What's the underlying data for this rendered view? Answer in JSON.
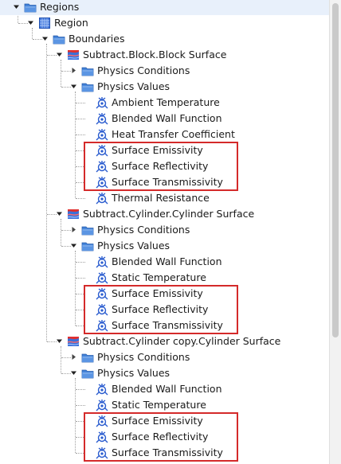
{
  "tree": [
    {
      "label": "Regions",
      "level": 1,
      "icon": "folder",
      "toggle": "expanded"
    },
    {
      "label": "Region",
      "level": 2,
      "icon": "region",
      "toggle": "expanded"
    },
    {
      "label": "Boundaries",
      "level": 3,
      "icon": "folder",
      "toggle": "expanded"
    },
    {
      "label": "Subtract.Block.Block Surface",
      "level": 4,
      "icon": "boundary",
      "toggle": "expanded"
    },
    {
      "label": "Physics Conditions",
      "level": 5,
      "icon": "folder",
      "toggle": "collapsed"
    },
    {
      "label": "Physics Values",
      "level": 5,
      "icon": "folder",
      "toggle": "expanded"
    },
    {
      "label": "Ambient Temperature",
      "level": 6,
      "icon": "value",
      "toggle": "none"
    },
    {
      "label": "Blended Wall Function",
      "level": 6,
      "icon": "value",
      "toggle": "none"
    },
    {
      "label": "Heat Transfer Coefficient",
      "level": 6,
      "icon": "value",
      "toggle": "none"
    },
    {
      "label": "Surface Emissivity",
      "level": 6,
      "icon": "value",
      "toggle": "none"
    },
    {
      "label": "Surface Reflectivity",
      "level": 6,
      "icon": "value",
      "toggle": "none"
    },
    {
      "label": "Surface Transmissivity",
      "level": 6,
      "icon": "value",
      "toggle": "none"
    },
    {
      "label": "Thermal Resistance",
      "level": 6,
      "icon": "value",
      "toggle": "none"
    },
    {
      "label": "Subtract.Cylinder.Cylinder Surface",
      "level": 4,
      "icon": "boundary",
      "toggle": "expanded"
    },
    {
      "label": "Physics Conditions",
      "level": 5,
      "icon": "folder",
      "toggle": "collapsed"
    },
    {
      "label": "Physics Values",
      "level": 5,
      "icon": "folder",
      "toggle": "expanded"
    },
    {
      "label": "Blended Wall Function",
      "level": 6,
      "icon": "value",
      "toggle": "none"
    },
    {
      "label": "Static Temperature",
      "level": 6,
      "icon": "value",
      "toggle": "none"
    },
    {
      "label": "Surface Emissivity",
      "level": 6,
      "icon": "value",
      "toggle": "none"
    },
    {
      "label": "Surface Reflectivity",
      "level": 6,
      "icon": "value",
      "toggle": "none"
    },
    {
      "label": "Surface Transmissivity",
      "level": 6,
      "icon": "value",
      "toggle": "none"
    },
    {
      "label": "Subtract.Cylinder copy.Cylinder Surface",
      "level": 4,
      "icon": "boundary",
      "toggle": "expanded"
    },
    {
      "label": "Physics Conditions",
      "level": 5,
      "icon": "folder",
      "toggle": "collapsed"
    },
    {
      "label": "Physics Values",
      "level": 5,
      "icon": "folder",
      "toggle": "expanded"
    },
    {
      "label": "Blended Wall Function",
      "level": 6,
      "icon": "value",
      "toggle": "none"
    },
    {
      "label": "Static Temperature",
      "level": 6,
      "icon": "value",
      "toggle": "none"
    },
    {
      "label": "Surface Emissivity",
      "level": 6,
      "icon": "value",
      "toggle": "none"
    },
    {
      "label": "Surface Reflectivity",
      "level": 6,
      "icon": "value",
      "toggle": "none"
    },
    {
      "label": "Surface Transmissivity",
      "level": 6,
      "icon": "value",
      "toggle": "none"
    }
  ],
  "highlight_groups": [
    [
      9,
      11
    ],
    [
      18,
      20
    ],
    [
      26,
      28
    ]
  ],
  "colors": {
    "highlight": "#d42a2a",
    "folder": "#3f7fd6",
    "value_icon": "#2a5ccf",
    "boundary_red": "#e03030",
    "boundary_blue": "#3a6fd8"
  }
}
